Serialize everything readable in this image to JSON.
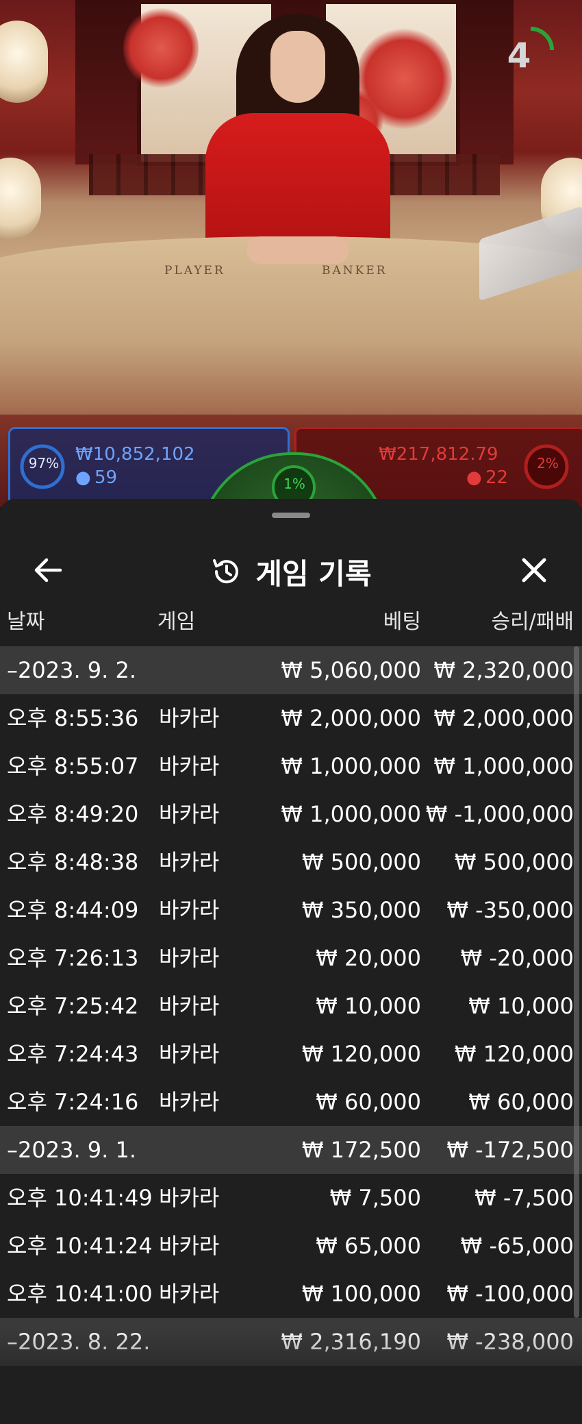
{
  "stage": {
    "timer_value": "4",
    "player_label": "PLAYER",
    "banker_label": "BANKER",
    "player_panel": {
      "percent": "97%",
      "amount": "₩10,852,102",
      "players": "59"
    },
    "banker_panel": {
      "percent": "2%",
      "amount": "₩217,812.79",
      "players": "22"
    },
    "tie_panel": {
      "percent": "1%"
    }
  },
  "history": {
    "title": "게임 기록",
    "back_icon": "arrow-left-icon",
    "close_icon": "close-icon",
    "columns": {
      "date": "날짜",
      "game": "게임",
      "bet": "베팅",
      "result": "승리/패배"
    },
    "rows": [
      {
        "type": "group",
        "time": "–2023. 9. 2.",
        "game": "",
        "bet": "₩ 5,060,000",
        "result": "₩ 2,320,000"
      },
      {
        "type": "item",
        "time": "오후 8:55:36",
        "game": "바카라",
        "bet": "₩ 2,000,000",
        "result": "₩ 2,000,000"
      },
      {
        "type": "item",
        "time": "오후 8:55:07",
        "game": "바카라",
        "bet": "₩ 1,000,000",
        "result": "₩ 1,000,000"
      },
      {
        "type": "item",
        "time": "오후 8:49:20",
        "game": "바카라",
        "bet": "₩ 1,000,000",
        "result": "₩ -1,000,000"
      },
      {
        "type": "item",
        "time": "오후 8:48:38",
        "game": "바카라",
        "bet": "₩ 500,000",
        "result": "₩ 500,000"
      },
      {
        "type": "item",
        "time": "오후 8:44:09",
        "game": "바카라",
        "bet": "₩ 350,000",
        "result": "₩ -350,000"
      },
      {
        "type": "item",
        "time": "오후 7:26:13",
        "game": "바카라",
        "bet": "₩ 20,000",
        "result": "₩ -20,000"
      },
      {
        "type": "item",
        "time": "오후 7:25:42",
        "game": "바카라",
        "bet": "₩ 10,000",
        "result": "₩ 10,000"
      },
      {
        "type": "item",
        "time": "오후 7:24:43",
        "game": "바카라",
        "bet": "₩ 120,000",
        "result": "₩ 120,000"
      },
      {
        "type": "item",
        "time": "오후 7:24:16",
        "game": "바카라",
        "bet": "₩ 60,000",
        "result": "₩ 60,000"
      },
      {
        "type": "group",
        "time": "–2023. 9. 1.",
        "game": "",
        "bet": "₩ 172,500",
        "result": "₩ -172,500"
      },
      {
        "type": "item",
        "time": "오후 10:41:49",
        "game": "바카라",
        "bet": "₩ 7,500",
        "result": "₩ -7,500"
      },
      {
        "type": "item",
        "time": "오후 10:41:24",
        "game": "바카라",
        "bet": "₩ 65,000",
        "result": "₩ -65,000"
      },
      {
        "type": "item",
        "time": "오후 10:41:00",
        "game": "바카라",
        "bet": "₩ 100,000",
        "result": "₩ -100,000"
      },
      {
        "type": "group",
        "time": "–2023. 8. 22.",
        "game": "",
        "bet": "₩ 2,316,190",
        "result": "₩ -238,000"
      }
    ]
  },
  "colors": {
    "player_blue": "#2e6fd3",
    "banker_red": "#b21e1e",
    "tie_green": "#2aa43a",
    "sheet_bg": "#1f1f1f",
    "group_row_bg": "#3a3a3a"
  }
}
